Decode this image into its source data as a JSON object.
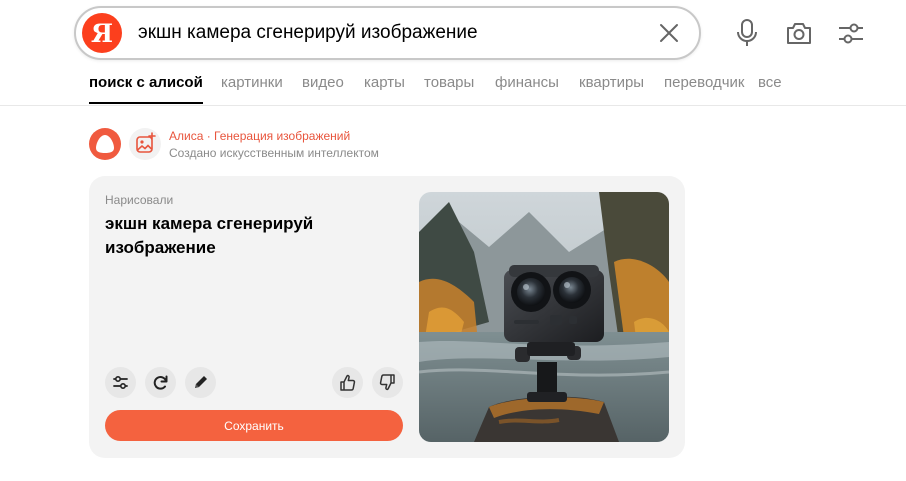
{
  "search": {
    "logo_letter": "Я",
    "query": "экшн камера сгенерируй изображение",
    "icons": [
      "clear-icon",
      "microphone-icon",
      "camera-search-icon",
      "filter-settings-icon"
    ]
  },
  "tabs": [
    {
      "label": "поиск с алисой",
      "active": true
    },
    {
      "label": "картинки"
    },
    {
      "label": "видео"
    },
    {
      "label": "карты"
    },
    {
      "label": "товары"
    },
    {
      "label": "финансы"
    },
    {
      "label": "квартиры"
    },
    {
      "label": "переводчик"
    },
    {
      "label": "все"
    }
  ],
  "source": {
    "title": "Алиса · Генерация изображений",
    "subtitle": "Создано искусственным интеллектом"
  },
  "result": {
    "label": "Нарисовали",
    "prompt": "экшн камера сгенерируй изображение",
    "save_label": "Сохранить",
    "image_subject": "action-camera-on-rock-by-mountain-river"
  },
  "colors": {
    "brand": "#fc3f1d",
    "accent": "#f4623f",
    "card_bg": "#f3f3f3"
  }
}
